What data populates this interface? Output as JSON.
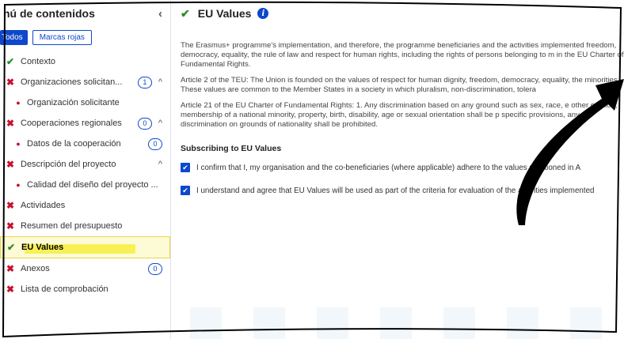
{
  "sidebar": {
    "title": "nú de contenidos",
    "close_icon": "‹",
    "filters": {
      "all": "Todos",
      "red": "Marcas rojas"
    },
    "items": [
      {
        "label": "Contexto",
        "status": "ok",
        "sub": false
      },
      {
        "label": "Organizaciones solicitan...",
        "status": "err",
        "count": "1",
        "chev": "^",
        "sub": false
      },
      {
        "label": "Organización solicitante",
        "status": "dot",
        "sub": true
      },
      {
        "label": "Cooperaciones regionales",
        "status": "err",
        "count": "0",
        "chev": "^",
        "sub": false
      },
      {
        "label": "Datos de la cooperación",
        "status": "dot",
        "count": "0",
        "sub": true
      },
      {
        "label": "Descripción del proyecto",
        "status": "err",
        "chev": "^",
        "sub": false
      },
      {
        "label": "Calidad del diseño del proyecto ...",
        "status": "dot",
        "sub": true
      },
      {
        "label": "Actividades",
        "status": "err",
        "sub": false
      },
      {
        "label": "Resumen del presupuesto",
        "status": "err",
        "sub": false
      },
      {
        "label": "EU Values",
        "status": "ok",
        "sub": false,
        "active": true
      },
      {
        "label": "Anexos",
        "status": "err",
        "count": "0",
        "sub": false
      },
      {
        "label": "Lista de comprobación",
        "status": "err",
        "sub": false
      }
    ]
  },
  "main": {
    "title": "EU Values",
    "info_icon": "i",
    "paragraphs": [
      "The Erasmus+ programme's implementation, and therefore, the programme beneficiaries and the activities implemented freedom, democracy, equality, the rule of law and respect for human rights, including the rights of persons belonging to m in the EU Charter of Fundamental Rights.",
      "Article 2 of the TEU: The Union is founded on the values of respect for human dignity, freedom, democracy, equality, the minorities. These values are common to the Member States in a society in which pluralism, non-discrimination, tolera",
      "Article 21 of the EU Charter of Fundamental Rights: 1. Any discrimination based on any ground such as sex, race, e other opinion, membership of a national minority, property, birth, disability, age or sexual orientation shall be p specific provisions, any discrimination on grounds of nationality shall be prohibited."
    ],
    "subheading": "Subscribing to EU Values",
    "checks": [
      "I confirm that I, my organisation and the co-beneficiaries (where applicable) adhere to the values mentioned in A",
      "I understand and agree that EU Values will be used as part of the criteria for evaluation of the activities implemented"
    ]
  },
  "colors": {
    "primary": "#0e47cb",
    "success": "#2a8c2a",
    "error": "#c8102e",
    "highlight": "#f4ee2a"
  }
}
